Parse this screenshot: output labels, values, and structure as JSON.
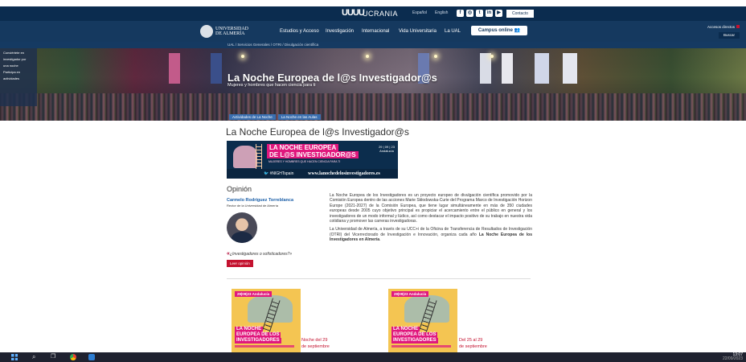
{
  "ribbon": {
    "ua_logo": "UUUU",
    "ucrania": "UCRANIA",
    "lang_es": "Español",
    "lang_en": "English",
    "contact": "Contacto"
  },
  "nav": {
    "logo_line1": "UNIVERSIDAD",
    "logo_line2": "DE ALMERÍA",
    "items": [
      "Estudios y Acceso",
      "Investigación",
      "Internacional",
      "Vida Universitaria",
      "La UAL"
    ],
    "campus_button": "Campus online",
    "direct_access": "Accesos directos",
    "search": "Buscar"
  },
  "breadcrumb": "UAL / Servicios Generales / OTRI / Divulgación científica",
  "hero": {
    "left_panel_lines": [
      "Conviértete en",
      "investigador por",
      "una noche",
      "",
      "Participa en",
      "actividades"
    ],
    "title": "La Noche Europea de l@s Investigador@s",
    "subtitle": "Mujeres y hombres que hacen ciencia para ti",
    "tabs": [
      "Actividades de La Noche",
      "La Noche en las Aulas"
    ]
  },
  "main": {
    "page_title": "La Noche Europea de l@s Investigador@s",
    "promo": {
      "line1": "LA NOCHE EUROPEA",
      "line2": "DE L@S INVESTIGADOR@S",
      "tagline": "MUJERES Y HOMBRES QUE HACEN CIENCIA PARA TI",
      "date_line1": "29 | 09 | 23",
      "date_line2": "Andalucía",
      "hashtag": "#NIGHTspain",
      "url": "www.lanochedelosinvestigadores.es"
    },
    "opinion": {
      "title": "Opinión",
      "author": "Carmelo Rodríguez Torreblanca",
      "role": "Rector de la Universidad de Almería",
      "quote_mark": "«",
      "quote": "¿Investigadores o sofisticadores?»",
      "read_button": "Leer opinión"
    },
    "description": {
      "p1": "La Noche Europea de los Investigadores es un proyecto europeo de divulgación científica promovido por la Comisión Europea dentro de las acciones Marie Skłodowska-Curie del Programa Marco de Investigación Horizon Europe (2021-2027) de la Comisión Europea, que tiene lugar simultáneamente en más de 350 ciudades europeas desde 2005 cuyo objetivo principal es propiciar el acercamiento entre el público en general y los investigadores de un modo informal y lúdico, así como destacar el impacto positivo de su trabajo en nuestra vida cotidiana y promover las carreras investigadoras.",
      "p2_start": "La Universidad de Almería, a través de su UCC+i de la Oficina de Transferencia de Resultados de Investigación (OTRI) del Vicerrectorado de Investigación e Innovación, organiza cada año ",
      "p2_bold": "La Noche Europea de los Investigadores en Almería",
      "p2_end": "."
    },
    "cards": [
      {
        "date": "29|09|23",
        "sub": "Andalucía",
        "t1": "LA NOCHE",
        "t2": "EUROPEA DE LOS",
        "t3": "INVESTIGADORES",
        "caption_line1": "Noche del 29",
        "caption_line2": "de septiembre"
      },
      {
        "date": "29|09|23",
        "sub": "Andalucía",
        "t1": "LA NOCHE",
        "t2": "EUROPEA DE LOS",
        "t3": "INVESTIGADORES",
        "caption_line1": "Del 25 al 29",
        "caption_line2": "de septiembre"
      }
    ]
  },
  "taskbar": {
    "time": "13:07",
    "date": "22/09/2023"
  }
}
